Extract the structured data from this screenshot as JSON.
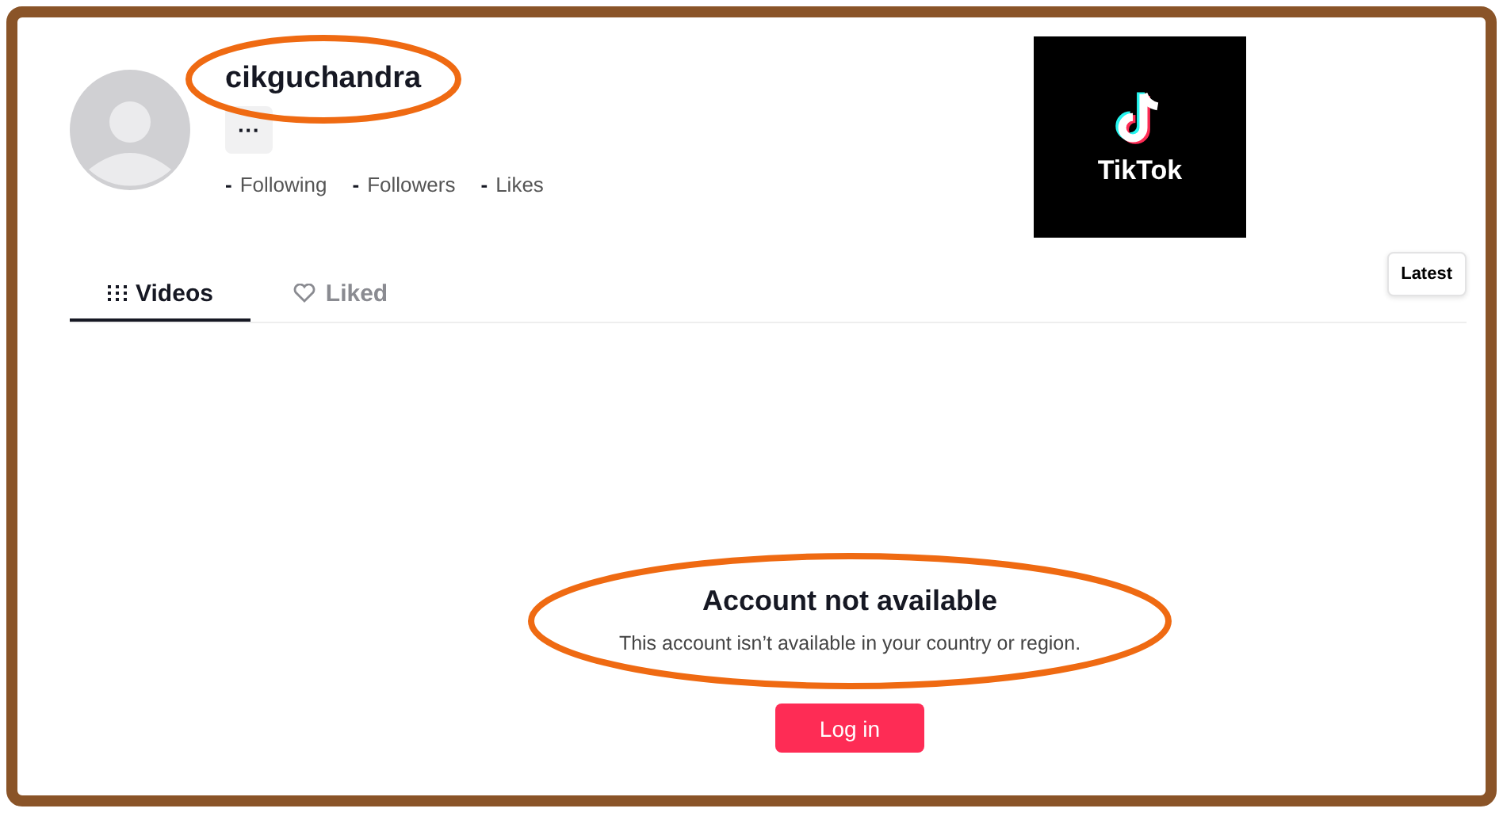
{
  "profile": {
    "username": "cikguchandra",
    "more_button": "···",
    "stats": [
      {
        "value": "-",
        "label": "Following"
      },
      {
        "value": "-",
        "label": "Followers"
      },
      {
        "value": "-",
        "label": "Likes"
      }
    ]
  },
  "logo": {
    "text": "TikTok"
  },
  "tabs": [
    {
      "label": "Videos",
      "kind": "videos",
      "selected": true
    },
    {
      "label": "Liked",
      "kind": "liked",
      "selected": false
    }
  ],
  "sort_button": "Latest",
  "message": {
    "title": "Account not available",
    "text": "This account isn’t available in your country or region.",
    "button": "Log in"
  }
}
